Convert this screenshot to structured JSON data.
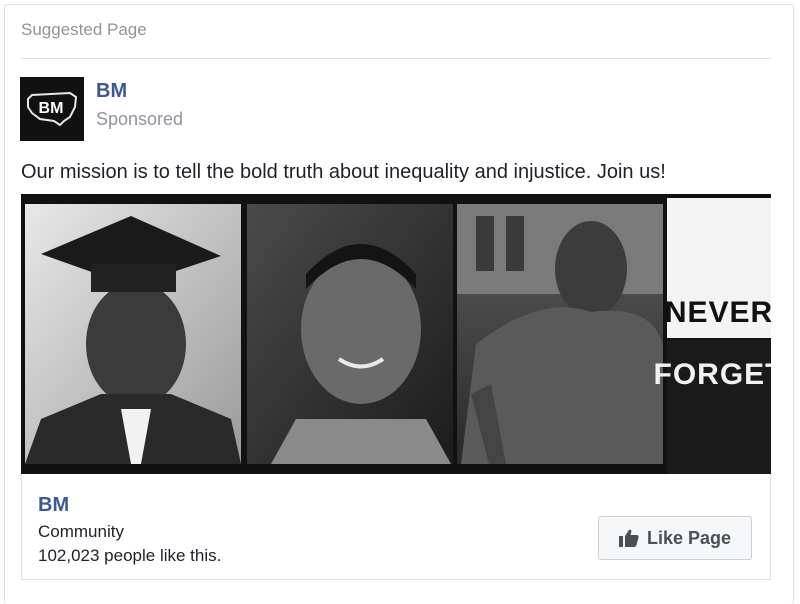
{
  "card": {
    "header_label": "Suggested Page"
  },
  "post": {
    "page_name": "BM",
    "sponsored_label": "Sponsored",
    "message": "Our mission is to tell the bold truth about inequality and injustice. Join us!"
  },
  "avatar": {
    "logo_text": "BM"
  },
  "media": {
    "poster_lines": [
      "NEVER",
      "FORGET"
    ]
  },
  "footer": {
    "page_name": "BM",
    "category": "Community",
    "likes_text": "102,023 people like this.",
    "like_button_label": "Like Page"
  },
  "colors": {
    "link_blue": "#3b5998",
    "muted_gray": "#90949c",
    "text_dark": "#1d2129"
  },
  "icons": {
    "like_button_icon": "thumbs-up-icon"
  }
}
